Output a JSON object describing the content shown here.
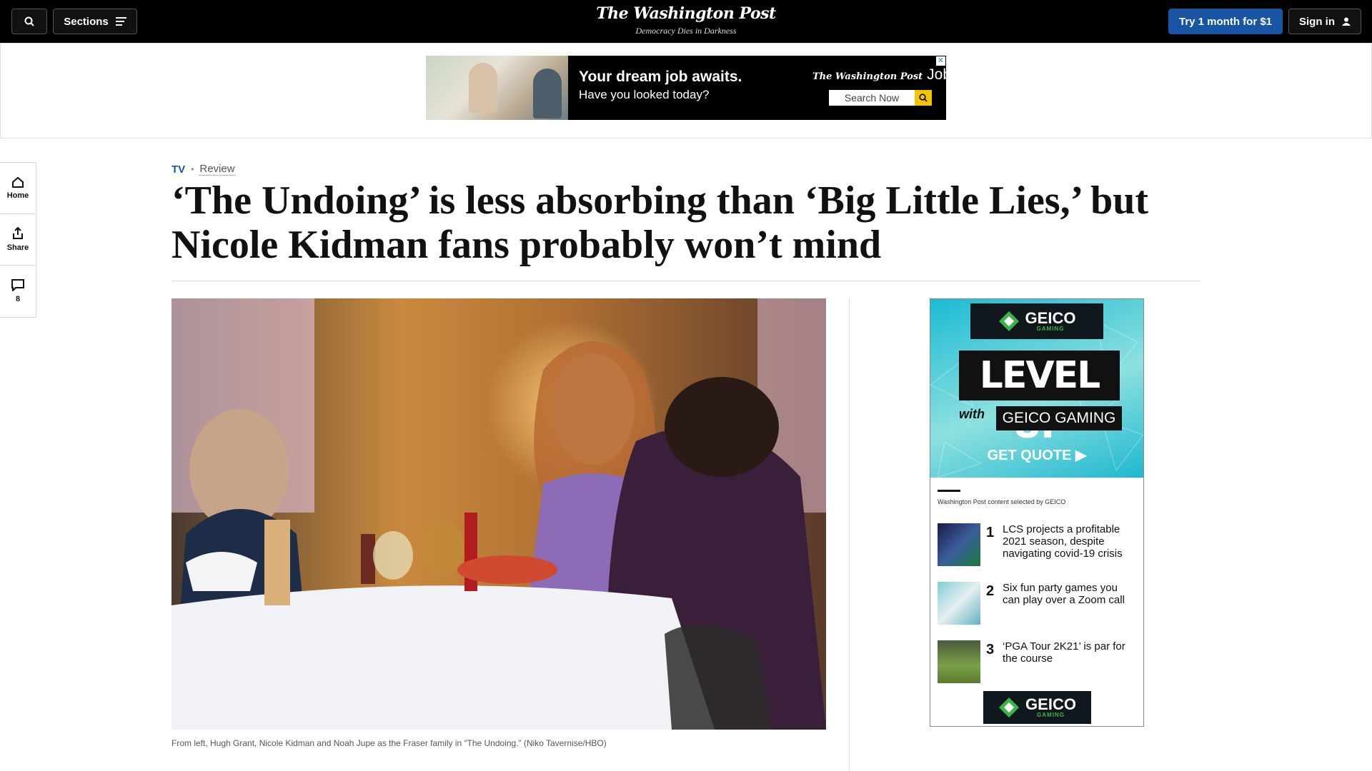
{
  "topbar": {
    "sections_label": "Sections",
    "logo": "The Washington Post",
    "tagline": "Democracy Dies in Darkness",
    "try_label": "Try 1 month for $1",
    "signin_label": "Sign in"
  },
  "banner_ad": {
    "headline": "Your dream job awaits.",
    "subline": "Have you looked today?",
    "brand": "The Washington Post",
    "brand_suffix": "Jobs",
    "search_label": "Search Now"
  },
  "rail": {
    "home": "Home",
    "share": "Share",
    "comments_count": "8"
  },
  "article": {
    "section": "TV",
    "label": "Review",
    "title": "‘The Undoing’ is less absorbing than ‘Big Little Lies,’ but Nicole Kidman fans probably won’t mind",
    "caption": "From left, Hugh Grant, Nicole Kidman and Noah Jupe as the Fraser family in “The Undoing.” (Niko Tavernise/HBO)"
  },
  "ad_module": {
    "brand": "GEICO",
    "brand_sub": "GAMING",
    "level_up": "LEVEL UP",
    "with": "with",
    "geico_gaming": "GEICO GAMING",
    "cta": "GET QUOTE ▶",
    "selected_by": "Washington Post content selected by GEICO",
    "stories": [
      {
        "num": "1",
        "text": "LCS projects a profitable 2021 season, despite navigating covid-19 crisis"
      },
      {
        "num": "2",
        "text": "Six fun party games you can play over a Zoom call"
      },
      {
        "num": "3",
        "text": "‘PGA Tour 2K21’ is par for the course"
      }
    ]
  },
  "colors": {
    "accent_blue": "#1955a5",
    "geico_teal": "#1bbbd3"
  }
}
